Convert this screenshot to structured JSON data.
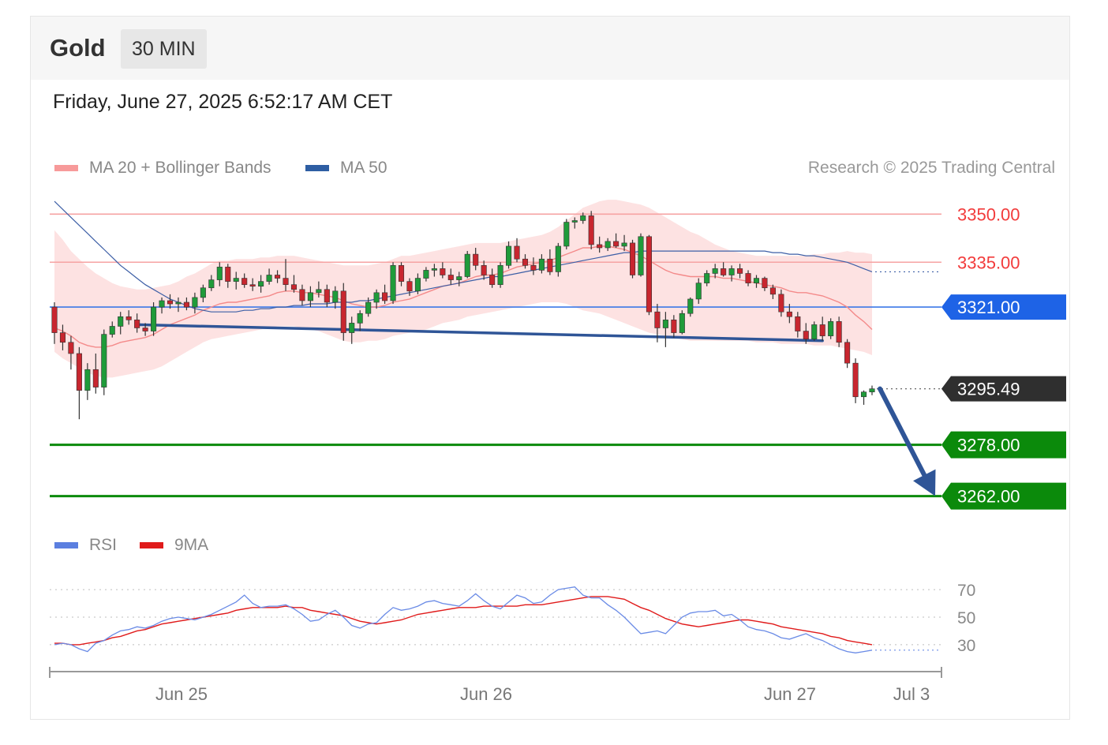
{
  "header": {
    "title": "Gold",
    "timeframe": "30 MIN"
  },
  "datetime": "Friday, June 27, 2025 6:52:17 AM CET",
  "legend": {
    "ma20_bb": {
      "label": "MA 20 + Bollinger Bands",
      "color": "#f27b7b"
    },
    "ma50": {
      "label": "MA 50",
      "color": "#2e5ea3"
    },
    "credit": "Research © 2025 Trading Central"
  },
  "rsi_legend": {
    "rsi": {
      "label": "RSI",
      "color": "#5b7fe0"
    },
    "ma9": {
      "label": "9MA",
      "color": "#e01b1b"
    }
  },
  "levels": [
    {
      "value": 3350.0,
      "label": "3350.00",
      "kind": "resistance",
      "color": "#f44336"
    },
    {
      "value": 3335.0,
      "label": "3335.00",
      "kind": "resistance",
      "color": "#f44336"
    },
    {
      "value": 3321.0,
      "label": "3321.00",
      "kind": "pivot",
      "color": "#1e63e6"
    },
    {
      "value": 3295.49,
      "label": "3295.49",
      "kind": "last",
      "color": "#333333"
    },
    {
      "value": 3278.0,
      "label": "3278.00",
      "kind": "support",
      "color": "#0b8a0b"
    },
    {
      "value": 3262.0,
      "label": "3262.00",
      "kind": "support",
      "color": "#0b8a0b"
    }
  ],
  "rsi_axis": {
    "ticks": [
      70,
      50,
      30
    ],
    "ylim": [
      15,
      85
    ]
  },
  "x_axis": {
    "labels": [
      "Jun 25",
      "Jun 26",
      "Jun 27",
      "Jul 3"
    ]
  },
  "chart_data": {
    "type": "candlestick",
    "ylim": [
      3256,
      3356
    ],
    "forecast_arrow": {
      "from": 3295.5,
      "to": 3262.0
    },
    "trendline": {
      "from": 3315.5,
      "to": 3310.5
    },
    "candles": [
      [
        3321.0,
        3322.5,
        3309.5,
        3313.0
      ],
      [
        3313.0,
        3315.5,
        3307.5,
        3310.0
      ],
      [
        3310.0,
        3312.0,
        3301.5,
        3306.5
      ],
      [
        3306.5,
        3308.5,
        3286.0,
        3295.0
      ],
      [
        3295.0,
        3303.5,
        3292.0,
        3301.5
      ],
      [
        3301.5,
        3306.5,
        3294.0,
        3296.0
      ],
      [
        3296.0,
        3314.0,
        3293.5,
        3312.5
      ],
      [
        3312.5,
        3316.5,
        3311.5,
        3315.0
      ],
      [
        3315.0,
        3319.5,
        3312.5,
        3318.0
      ],
      [
        3318.0,
        3320.0,
        3315.5,
        3317.0
      ],
      [
        3317.0,
        3319.0,
        3313.0,
        3314.5
      ],
      [
        3314.5,
        3316.0,
        3312.0,
        3313.5
      ],
      [
        3313.5,
        3322.5,
        3312.0,
        3321.0
      ],
      [
        3321.0,
        3324.0,
        3319.0,
        3323.0
      ],
      [
        3323.0,
        3325.0,
        3320.5,
        3322.0
      ],
      [
        3322.0,
        3324.0,
        3319.5,
        3322.5
      ],
      [
        3322.5,
        3324.0,
        3320.0,
        3321.0
      ],
      [
        3321.0,
        3325.5,
        3319.0,
        3324.0
      ],
      [
        3324.0,
        3328.0,
        3322.5,
        3327.0
      ],
      [
        3327.0,
        3331.0,
        3326.0,
        3329.5
      ],
      [
        3329.5,
        3335.0,
        3327.5,
        3333.5
      ],
      [
        3333.5,
        3334.5,
        3327.0,
        3329.0
      ],
      [
        3329.0,
        3332.0,
        3326.5,
        3330.0
      ],
      [
        3330.0,
        3331.5,
        3327.0,
        3328.0
      ],
      [
        3328.0,
        3330.0,
        3326.0,
        3327.5
      ],
      [
        3327.5,
        3331.0,
        3325.5,
        3329.0
      ],
      [
        3329.0,
        3333.0,
        3328.0,
        3331.0
      ],
      [
        3331.0,
        3332.5,
        3328.5,
        3330.0
      ],
      [
        3330.0,
        3336.0,
        3326.0,
        3328.0
      ],
      [
        3328.0,
        3331.0,
        3325.5,
        3326.5
      ],
      [
        3326.5,
        3328.0,
        3321.5,
        3323.0
      ],
      [
        3323.0,
        3327.5,
        3321.0,
        3325.5
      ],
      [
        3325.5,
        3329.0,
        3324.0,
        3326.5
      ],
      [
        3326.5,
        3328.0,
        3321.0,
        3322.5
      ],
      [
        3322.5,
        3327.5,
        3320.5,
        3326.0
      ],
      [
        3326.0,
        3328.5,
        3310.5,
        3313.0
      ],
      [
        3313.0,
        3318.0,
        3309.5,
        3316.0
      ],
      [
        3316.0,
        3320.0,
        3313.5,
        3319.0
      ],
      [
        3319.0,
        3324.0,
        3318.0,
        3322.5
      ],
      [
        3322.5,
        3326.5,
        3320.5,
        3325.5
      ],
      [
        3325.5,
        3328.0,
        3322.0,
        3323.0
      ],
      [
        3323.0,
        3335.0,
        3322.0,
        3334.0
      ],
      [
        3334.0,
        3335.0,
        3327.5,
        3329.0
      ],
      [
        3329.0,
        3330.0,
        3324.5,
        3326.0
      ],
      [
        3326.0,
        3331.5,
        3325.0,
        3330.0
      ],
      [
        3330.0,
        3333.5,
        3329.0,
        3332.5
      ],
      [
        3332.5,
        3334.5,
        3330.5,
        3333.0
      ],
      [
        3333.0,
        3335.0,
        3330.0,
        3331.0
      ],
      [
        3331.0,
        3333.0,
        3328.0,
        3329.5
      ],
      [
        3329.5,
        3332.0,
        3327.5,
        3330.5
      ],
      [
        3330.5,
        3338.5,
        3330.0,
        3337.5
      ],
      [
        3337.5,
        3339.5,
        3332.5,
        3334.0
      ],
      [
        3334.0,
        3335.5,
        3329.5,
        3331.0
      ],
      [
        3331.0,
        3333.0,
        3327.0,
        3328.0
      ],
      [
        3328.0,
        3335.0,
        3327.0,
        3334.0
      ],
      [
        3334.0,
        3341.5,
        3333.0,
        3340.0
      ],
      [
        3340.0,
        3342.5,
        3335.0,
        3336.0
      ],
      [
        3336.0,
        3337.5,
        3333.0,
        3334.0
      ],
      [
        3334.0,
        3336.5,
        3331.0,
        3332.5
      ],
      [
        3332.5,
        3337.5,
        3331.5,
        3336.0
      ],
      [
        3336.0,
        3339.0,
        3331.0,
        3332.0
      ],
      [
        3332.0,
        3341.0,
        3330.5,
        3340.0
      ],
      [
        3340.0,
        3348.5,
        3339.0,
        3347.5
      ],
      [
        3347.5,
        3349.0,
        3345.5,
        3348.0
      ],
      [
        3348.0,
        3350.5,
        3347.0,
        3349.5
      ],
      [
        3349.5,
        3351.0,
        3339.0,
        3340.5
      ],
      [
        3340.5,
        3343.0,
        3338.0,
        3339.5
      ],
      [
        3339.5,
        3342.5,
        3338.5,
        3341.5
      ],
      [
        3341.5,
        3344.0,
        3339.5,
        3340.0
      ],
      [
        3340.0,
        3343.5,
        3338.5,
        3341.0
      ],
      [
        3341.0,
        3342.0,
        3330.0,
        3331.0
      ],
      [
        3331.0,
        3344.0,
        3330.5,
        3343.0
      ],
      [
        3343.0,
        3343.5,
        3318.5,
        3319.5
      ],
      [
        3319.5,
        3322.0,
        3310.0,
        3314.5
      ],
      [
        3314.5,
        3319.5,
        3308.5,
        3317.0
      ],
      [
        3317.0,
        3318.5,
        3311.5,
        3313.0
      ],
      [
        3313.0,
        3320.0,
        3312.5,
        3319.0
      ],
      [
        3319.0,
        3324.0,
        3318.0,
        3323.5
      ],
      [
        3323.5,
        3330.0,
        3322.0,
        3328.5
      ],
      [
        3328.5,
        3332.5,
        3327.5,
        3331.5
      ],
      [
        3331.5,
        3334.5,
        3330.0,
        3333.0
      ],
      [
        3333.0,
        3335.0,
        3330.5,
        3331.0
      ],
      [
        3331.0,
        3334.0,
        3329.0,
        3333.0
      ],
      [
        3333.0,
        3334.5,
        3330.0,
        3331.5
      ],
      [
        3331.5,
        3332.5,
        3327.5,
        3328.5
      ],
      [
        3328.5,
        3331.0,
        3327.0,
        3330.0
      ],
      [
        3330.0,
        3330.5,
        3326.0,
        3327.0
      ],
      [
        3327.0,
        3328.0,
        3323.5,
        3325.0
      ],
      [
        3325.0,
        3326.5,
        3318.0,
        3319.5
      ],
      [
        3319.5,
        3322.0,
        3316.0,
        3318.0
      ],
      [
        3318.0,
        3319.5,
        3311.5,
        3313.5
      ],
      [
        3313.5,
        3316.0,
        3309.5,
        3311.0
      ],
      [
        3311.0,
        3316.5,
        3310.5,
        3315.5
      ],
      [
        3315.5,
        3318.0,
        3310.5,
        3312.0
      ],
      [
        3312.0,
        3317.5,
        3311.0,
        3316.5
      ],
      [
        3316.5,
        3318.0,
        3308.5,
        3310.0
      ],
      [
        3310.0,
        3311.0,
        3302.0,
        3303.5
      ],
      [
        3303.5,
        3305.0,
        3291.0,
        3293.0
      ],
      [
        3293.0,
        3295.0,
        3290.5,
        3294.5
      ],
      [
        3294.5,
        3296.5,
        3293.5,
        3295.5
      ]
    ],
    "ma20": [
      3314.5,
      3313.5,
      3312.0,
      3310.0,
      3309.0,
      3308.5,
      3308.5,
      3309.0,
      3310.0,
      3310.5,
      3311.0,
      3311.5,
      3312.5,
      3314.0,
      3315.5,
      3316.5,
      3317.5,
      3318.5,
      3320.0,
      3321.0,
      3322.0,
      3322.5,
      3322.5,
      3323.0,
      3323.5,
      3324.0,
      3324.5,
      3325.5,
      3326.0,
      3326.0,
      3325.5,
      3325.5,
      3325.0,
      3324.5,
      3324.0,
      3323.0,
      3322.0,
      3321.5,
      3321.0,
      3321.0,
      3321.5,
      3322.5,
      3323.0,
      3323.5,
      3324.5,
      3325.5,
      3326.5,
      3327.5,
      3328.0,
      3328.5,
      3329.5,
      3330.5,
      3331.0,
      3331.0,
      3331.5,
      3332.5,
      3333.5,
      3334.0,
      3334.5,
      3335.0,
      3335.5,
      3336.5,
      3337.5,
      3338.5,
      3339.5,
      3339.5,
      3340.0,
      3340.0,
      3339.5,
      3339.0,
      3338.0,
      3337.0,
      3335.5,
      3334.0,
      3332.5,
      3331.5,
      3331.0,
      3330.5,
      3330.5,
      3330.5,
      3330.5,
      3330.0,
      3330.0,
      3329.5,
      3329.0,
      3328.5,
      3328.0,
      3327.5,
      3327.0,
      3326.0,
      3325.5,
      3325.5,
      3325.0,
      3324.5,
      3323.5,
      3322.5,
      3321.0,
      3318.5,
      3316.5,
      3314.0
    ],
    "bb_upper": [
      3345.0,
      3342.0,
      3338.5,
      3336.0,
      3333.5,
      3331.5,
      3330.0,
      3328.5,
      3327.5,
      3327.0,
      3326.5,
      3326.5,
      3327.0,
      3327.5,
      3328.0,
      3329.0,
      3330.5,
      3331.5,
      3333.0,
      3334.5,
      3335.5,
      3335.5,
      3336.0,
      3336.0,
      3336.0,
      3336.5,
      3336.5,
      3337.0,
      3337.0,
      3337.0,
      3336.5,
      3336.0,
      3335.5,
      3335.0,
      3334.5,
      3334.0,
      3334.0,
      3334.0,
      3334.0,
      3334.5,
      3335.0,
      3336.0,
      3337.0,
      3337.0,
      3337.5,
      3338.0,
      3338.5,
      3339.0,
      3339.5,
      3340.0,
      3340.5,
      3341.0,
      3341.0,
      3341.0,
      3341.0,
      3341.5,
      3342.0,
      3342.5,
      3343.0,
      3343.5,
      3344.5,
      3346.0,
      3348.0,
      3350.0,
      3352.0,
      3353.0,
      3354.0,
      3354.5,
      3354.5,
      3354.0,
      3353.5,
      3353.0,
      3352.0,
      3350.5,
      3349.0,
      3347.5,
      3346.0,
      3344.5,
      3343.5,
      3342.0,
      3340.5,
      3339.5,
      3338.5,
      3338.0,
      3337.5,
      3337.0,
      3337.0,
      3337.0,
      3337.0,
      3337.0,
      3337.0,
      3337.0,
      3337.5,
      3337.5,
      3338.0,
      3338.0,
      3338.5,
      3338.0,
      3338.0,
      3337.5
    ],
    "bb_lower": [
      3307.0,
      3305.0,
      3303.5,
      3302.0,
      3300.5,
      3299.5,
      3299.0,
      3299.0,
      3299.5,
      3300.0,
      3300.5,
      3301.0,
      3301.5,
      3302.5,
      3304.0,
      3305.5,
      3307.0,
      3308.5,
      3310.0,
      3311.0,
      3311.5,
      3312.0,
      3312.5,
      3313.0,
      3313.5,
      3314.0,
      3314.5,
      3315.0,
      3315.0,
      3315.0,
      3314.5,
      3314.0,
      3313.5,
      3312.5,
      3311.5,
      3310.5,
      3310.0,
      3310.0,
      3310.5,
      3310.5,
      3311.0,
      3312.0,
      3312.5,
      3313.0,
      3313.5,
      3314.0,
      3315.0,
      3316.0,
      3316.5,
      3317.0,
      3318.0,
      3318.5,
      3319.0,
      3319.5,
      3320.0,
      3320.5,
      3321.0,
      3321.5,
      3322.0,
      3322.5,
      3322.5,
      3322.5,
      3322.0,
      3321.0,
      3320.0,
      3319.5,
      3319.0,
      3318.0,
      3317.0,
      3316.0,
      3315.0,
      3314.0,
      3313.0,
      3312.5,
      3312.0,
      3311.5,
      3311.0,
      3310.5,
      3310.5,
      3310.5,
      3310.5,
      3310.5,
      3310.5,
      3310.5,
      3310.5,
      3310.0,
      3310.0,
      3310.0,
      3309.5,
      3309.5,
      3309.5,
      3309.5,
      3309.0,
      3309.0,
      3309.0,
      3308.5,
      3308.0,
      3307.5,
      3307.0,
      3306.0
    ],
    "ma50": [
      3354.0,
      3351.5,
      3349.0,
      3346.5,
      3344.0,
      3341.5,
      3339.0,
      3336.5,
      3334.0,
      3332.0,
      3330.0,
      3328.0,
      3326.5,
      3325.0,
      3323.5,
      3322.5,
      3321.5,
      3320.5,
      3320.0,
      3319.5,
      3319.5,
      3319.5,
      3319.5,
      3320.0,
      3320.0,
      3320.5,
      3320.5,
      3321.0,
      3321.0,
      3321.5,
      3321.5,
      3322.0,
      3322.0,
      3322.0,
      3322.5,
      3322.5,
      3322.5,
      3323.0,
      3323.0,
      3323.5,
      3324.0,
      3324.5,
      3325.0,
      3325.5,
      3326.0,
      3326.5,
      3327.0,
      3327.5,
      3328.0,
      3328.5,
      3329.0,
      3329.5,
      3330.0,
      3330.5,
      3330.5,
      3331.0,
      3331.5,
      3332.0,
      3332.5,
      3333.0,
      3333.5,
      3334.0,
      3334.5,
      3335.0,
      3335.5,
      3336.0,
      3336.5,
      3337.0,
      3337.5,
      3338.0,
      3338.0,
      3338.5,
      3338.5,
      3338.5,
      3338.5,
      3338.5,
      3338.5,
      3338.5,
      3338.5,
      3338.5,
      3338.5,
      3338.5,
      3338.5,
      3338.5,
      3338.5,
      3338.5,
      3338.5,
      3338.0,
      3338.0,
      3337.5,
      3337.5,
      3337.0,
      3337.0,
      3336.5,
      3336.0,
      3335.5,
      3335.0,
      3334.0,
      3333.0,
      3332.0
    ],
    "rsi": [
      30,
      31,
      30,
      27,
      25,
      31,
      33,
      37,
      40,
      41,
      43,
      42,
      44,
      47,
      49,
      50,
      49,
      48,
      50,
      52,
      55,
      58,
      61,
      66,
      60,
      57,
      58,
      58,
      59,
      56,
      52,
      47,
      48,
      52,
      55,
      50,
      44,
      42,
      45,
      46,
      52,
      57,
      55,
      56,
      58,
      61,
      62,
      60,
      59,
      58,
      62,
      67,
      62,
      58,
      56,
      61,
      66,
      64,
      60,
      61,
      66,
      70,
      71,
      72,
      66,
      64,
      64,
      59,
      55,
      50,
      44,
      38,
      39,
      40,
      38,
      44,
      50,
      53,
      54,
      54,
      55,
      51,
      52,
      48,
      43,
      41,
      40,
      38,
      35,
      34,
      36,
      38,
      35,
      33,
      30,
      27,
      25,
      24,
      25,
      26
    ],
    "rsi_ma9": [
      31,
      31,
      30,
      30,
      31,
      32,
      33,
      35,
      36,
      38,
      40,
      41,
      43,
      45,
      46,
      47,
      48,
      49,
      50,
      51,
      52,
      53,
      55,
      56,
      57,
      57,
      57,
      57,
      58,
      57,
      57,
      55,
      54,
      53,
      52,
      51,
      49,
      47,
      46,
      45,
      46,
      47,
      48,
      50,
      52,
      53,
      54,
      55,
      56,
      57,
      57,
      57,
      58,
      58,
      58,
      58,
      58,
      59,
      59,
      59,
      60,
      61,
      62,
      63,
      64,
      65,
      65,
      65,
      64,
      63,
      60,
      57,
      55,
      52,
      49,
      47,
      45,
      44,
      43,
      44,
      45,
      46,
      47,
      48,
      48,
      47,
      46,
      45,
      43,
      42,
      41,
      40,
      39,
      38,
      36,
      35,
      33,
      32,
      31,
      30
    ]
  }
}
